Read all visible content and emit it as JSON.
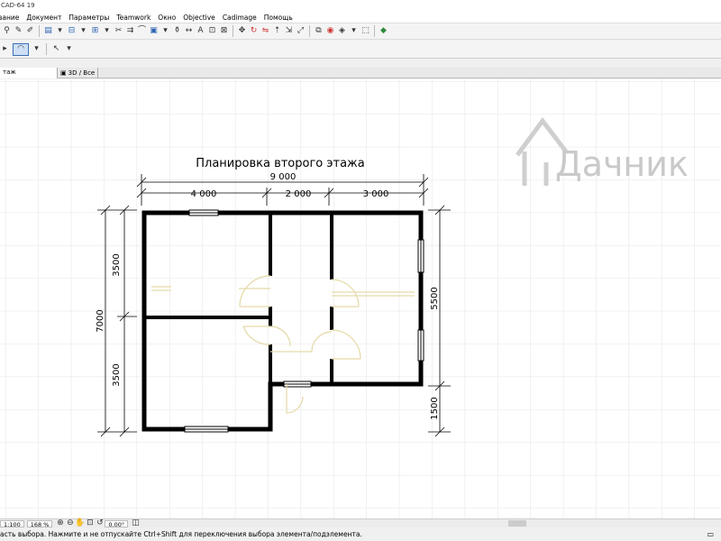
{
  "window": {
    "title": "CAD-64 19"
  },
  "menu": {
    "items": [
      "вание",
      "Документ",
      "Параметры",
      "Teamwork",
      "Окно",
      "Objective",
      "Cadimage",
      "Помощь"
    ]
  },
  "tabs": {
    "active": "тaж",
    "second": "3D / Все"
  },
  "drawing": {
    "title": "Планировка второго этажа",
    "dim_total_top": "9 000",
    "dim_seg1": "4 000",
    "dim_seg2": "2 000",
    "dim_seg3": "3 000",
    "dim_left_total": "7000",
    "dim_left_top": "3500",
    "dim_left_bottom": "3500",
    "dim_right_top": "5500",
    "dim_right_bottom": "1500"
  },
  "watermark": {
    "text": "Дачник"
  },
  "bottom": {
    "scale": "1:100",
    "zoom": "168 %",
    "angle": "0.00°"
  },
  "status": {
    "text": "асть выбора. Нажмите и не отпускайте Ctrl+Shift для переключения выбора элемента/подэлемента."
  }
}
